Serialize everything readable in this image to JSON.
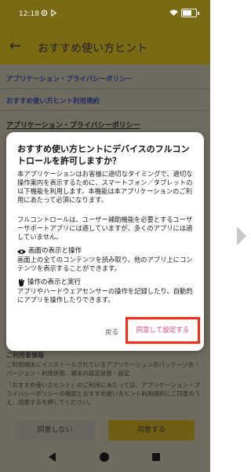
{
  "statusbar": {
    "time": "12:18"
  },
  "appbar": {
    "title": "おすすめ使い方ヒント"
  },
  "links": [
    "アプリケーション・プライバシーポリシー",
    "おすすめ使い方ヒント利用規約"
  ],
  "section_title": "アプリケーション・プライバシーポリシー",
  "background": {
    "info_heading": "ご利用者情報",
    "info_text": "ご利用端末にインストールされているアプリケーションのパッケージ名・バージョン・利用状態、端末の設定状態・設定",
    "notice_text": "「おすすめ使い方ヒント」のご利用にあたっては、アプリケーション・プライバシーポリシーの確認とおすすめ使い方ヒント利用規約にご同意のうえ、同意するを押してください。",
    "deny_label": "同意しない",
    "agree_label": "同意する"
  },
  "dialog": {
    "title": "おすすめ使い方ヒントにデバイスのフルコントロールを許可しますか？",
    "para1": "本アプリケーションはお客様に適切なタイミングで、適切な操作案内を表示するために、スマートフォン／タブレットの以下機能を利用します。本機能は本アプリケーションのご利用にあたって必須になります。",
    "para2": "フルコントロールは、ユーザー補助機能を必要とするユーザーサポートアプリには適していますが、多くのアプリには適していません。",
    "perm1_title": "画面の表示と操作",
    "perm1_desc": "画面上の全てのコンテンツを読み取り、他のアプリ上にコンテンツを表示することができます。",
    "perm2_title": "操作の表示と実行",
    "perm2_desc": "アプリやハードウェアセンサーの操作を記録したり、自動的にアプリを操作したりできます。",
    "cancel_label": "戻る",
    "ok_label": "同意して設定する"
  }
}
